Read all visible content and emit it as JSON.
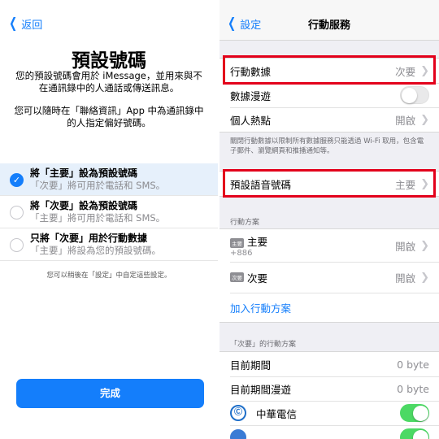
{
  "left": {
    "back_label": "返回",
    "title": "預設號碼",
    "desc1": "您的預設號碼會用於 iMessage，並用來與不在通訊錄中的人通話或傳送訊息。",
    "desc2": "您可以隨時在「聯絡資訊」App 中為通訊錄中的人指定偏好號碼。",
    "options": [
      {
        "title": "將「主要」設為預設號碼",
        "subtitle": "「次要」將可用於電話和 SMS。",
        "selected": true
      },
      {
        "title": "將「次要」設為預設號碼",
        "subtitle": "「主要」將可用於電話和 SMS。",
        "selected": false
      },
      {
        "title": "只將「次要」用於行動數據",
        "subtitle": "「主要」將設為您的預設號碼。",
        "selected": false
      }
    ],
    "footnote": "您可以稍後在「設定」中自定這些設定。",
    "done_label": "完成"
  },
  "right": {
    "back_label": "設定",
    "nav_title": "行動服務",
    "cellular_data": {
      "label": "行動數據",
      "value": "次要"
    },
    "data_roaming": {
      "label": "數據漫遊",
      "on": false
    },
    "hotspot": {
      "label": "個人熱點",
      "value": "開啟"
    },
    "footer1": "關閉行動數據以限制所有數據服務只能透過 Wi-Fi 取用，包含電子郵件、瀏覽網頁和推播通知等。",
    "default_voice": {
      "label": "預設語音號碼",
      "value": "主要"
    },
    "plans_header": "行動方案",
    "plan_primary": {
      "badge": "主要",
      "label": "主要",
      "number": "+886",
      "value": "開啟"
    },
    "plan_secondary": {
      "badge": "次要",
      "label": "次要",
      "value": "開啟"
    },
    "add_plan": "加入行動方案",
    "secondary_header": "「次要」的行動方案",
    "period": {
      "label": "目前期間",
      "value": "0 byte"
    },
    "period_roaming": {
      "label": "目前期間漫遊",
      "value": "0 byte"
    },
    "carrier": {
      "label": "中華電信",
      "on": true
    },
    "highlight_color": "#e3001b",
    "accent_color": "#147efb"
  }
}
